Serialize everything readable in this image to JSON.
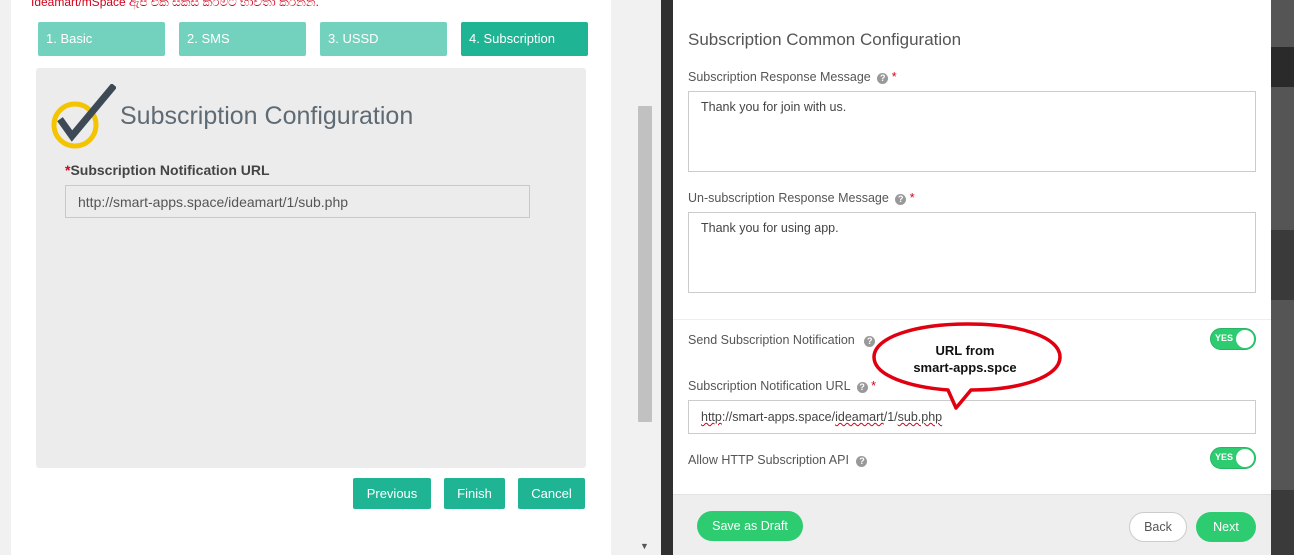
{
  "top_note": "Ideamart/mSpace ඇප් එක සකස් කිරීමට භාවිතා කරන්න.",
  "wizard": {
    "steps": [
      {
        "label": "1. Basic",
        "active": false
      },
      {
        "label": "2. SMS",
        "active": false
      },
      {
        "label": "3. USSD",
        "active": false
      },
      {
        "label": "4. Subscription",
        "active": true
      }
    ]
  },
  "subscription_card": {
    "title": "Subscription Configuration",
    "url_label_required": "*",
    "url_label": "Subscription Notification URL",
    "url_value": "http://smart-apps.space/ideamart/1/sub.php",
    "icon": "checkmark-circle-icon"
  },
  "left_buttons": {
    "previous": "Previous",
    "finish": "Finish",
    "cancel": "Cancel"
  },
  "modal": {
    "title": "Subscription Common Configuration",
    "sub_response_label": "Subscription Response Message",
    "sub_response_value": "Thank you for join with us.",
    "unsub_response_label": "Un-subscription Response Message",
    "unsub_response_value": "Thank you for using app.",
    "send_notification_label": "Send Subscription Notification",
    "notification_url_label": "Subscription Notification URL",
    "notification_url_parts": [
      "http",
      "://smart-apps.space/",
      "ideamart",
      "/1/",
      "sub.php"
    ],
    "allow_http_label": "Allow HTTP Subscription API",
    "required_mark": "*",
    "help_mark": "?",
    "toggle_yes": "YES",
    "send_notification_on": true,
    "allow_http_on": true,
    "footer": {
      "save_draft": "Save as Draft",
      "back": "Back",
      "next": "Next"
    }
  },
  "callout": {
    "line1": "URL from",
    "line2": "smart-apps.spce"
  },
  "colors": {
    "wizard_step": "#72d2bd",
    "wizard_step_active": "#1fb494",
    "primary_button": "#1fb494",
    "toggle_on": "#2ecc71",
    "required": "#d0021b",
    "callout_border": "#e0000f"
  }
}
